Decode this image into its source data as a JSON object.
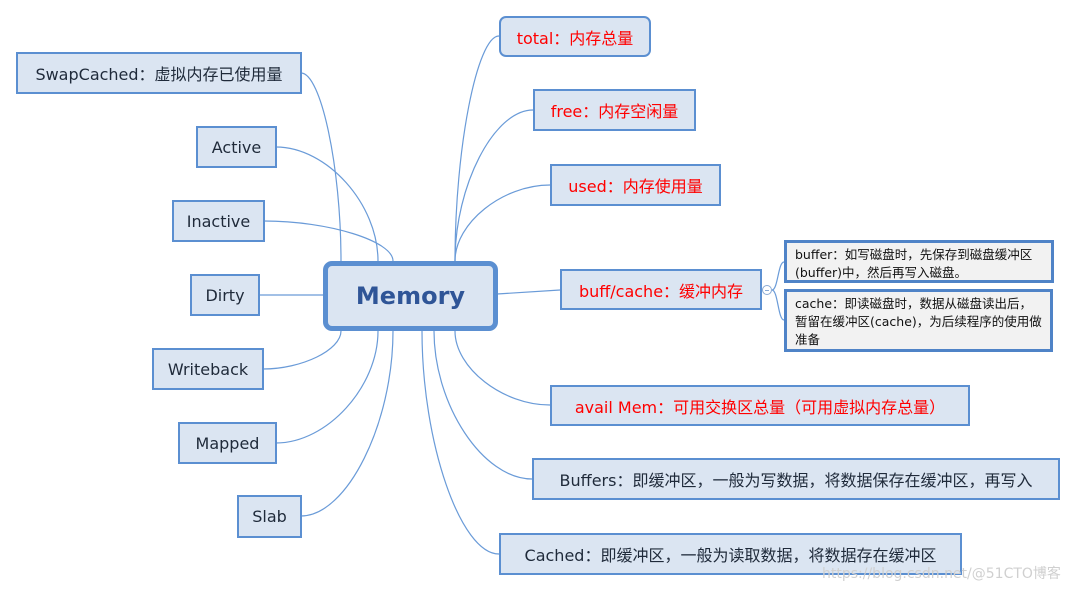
{
  "center": {
    "label": "Memory"
  },
  "right_nodes": [
    {
      "key": "total",
      "label": "total：内存总量",
      "color": "red"
    },
    {
      "key": "free",
      "label": "free：内存空闲量",
      "color": "red"
    },
    {
      "key": "used",
      "label": "used：内存使用量",
      "color": "red"
    },
    {
      "key": "buff-cache",
      "label": "buff/cache：缓冲内存",
      "color": "red",
      "children": [
        {
          "key": "buffer-note",
          "label": "buffer：如写磁盘时，先保存到磁盘缓冲区(buffer)中，然后再写入磁盘。"
        },
        {
          "key": "cache-note",
          "label": "cache：即读磁盘时，数据从磁盘读出后，暂留在缓冲区(cache)，为后续程序的使用做准备"
        }
      ]
    },
    {
      "key": "avail-mem",
      "label": "avail Mem：可用交换区总量（可用虚拟内存总量）",
      "color": "red"
    },
    {
      "key": "buffers",
      "label": "Buffers：即缓冲区，一般为写数据，将数据保存在缓冲区，再写入",
      "color": "dark"
    },
    {
      "key": "cached",
      "label": "Cached：即缓冲区，一般为读取数据，将数据存在缓冲区",
      "color": "dark"
    }
  ],
  "left_nodes": [
    {
      "key": "swapcached",
      "label": "SwapCached：虚拟内存已使用量"
    },
    {
      "key": "active",
      "label": "Active"
    },
    {
      "key": "inactive",
      "label": "Inactive"
    },
    {
      "key": "dirty",
      "label": "Dirty"
    },
    {
      "key": "writeback",
      "label": "Writeback"
    },
    {
      "key": "mapped",
      "label": "Mapped"
    },
    {
      "key": "slab",
      "label": "Slab"
    }
  ],
  "watermark": "https://blog.csdn.net/@51CTO博客",
  "colors": {
    "node_fill": "#dbe5f2",
    "node_border": "#5b8fd1",
    "link": "#6a9bd8",
    "highlight_text": "#ff0000"
  }
}
